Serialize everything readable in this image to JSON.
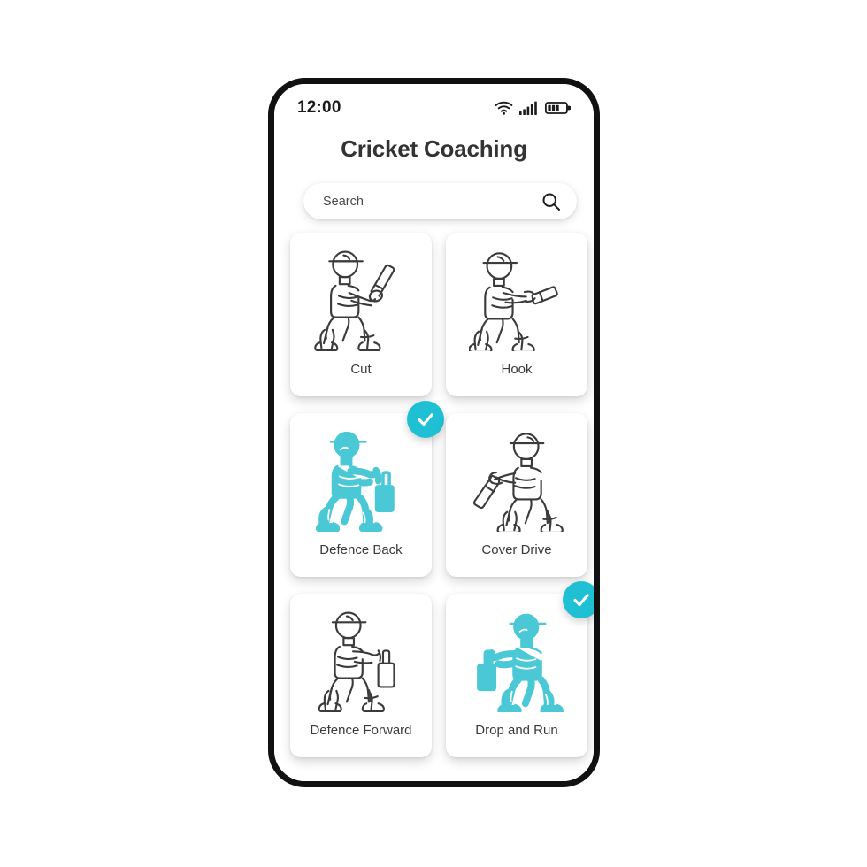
{
  "meta": {
    "accent_color": "#20c0d4",
    "figure_accent_color": "#4ac8d6",
    "outline_color": "#3b3b3b",
    "title_color": "#333333"
  },
  "status_bar": {
    "time": "12:00",
    "icons": [
      "wifi-icon",
      "cellular-signal-icon",
      "battery-icon"
    ]
  },
  "header": {
    "title": "Cricket Coaching"
  },
  "search": {
    "value": "",
    "placeholder": "Search",
    "icon": "search-icon"
  },
  "grid": {
    "cards": [
      {
        "label": "Cut",
        "selected": false,
        "figure": "batsman-cut-icon"
      },
      {
        "label": "Hook",
        "selected": false,
        "figure": "batsman-hook-icon"
      },
      {
        "label": "Defence Back",
        "selected": true,
        "figure": "batsman-defence-back-icon"
      },
      {
        "label": "Cover Drive",
        "selected": false,
        "figure": "batsman-cover-drive-icon"
      },
      {
        "label": "Defence Forward",
        "selected": false,
        "figure": "batsman-defence-forward-icon"
      },
      {
        "label": "Drop and Run",
        "selected": true,
        "figure": "batsman-drop-and-run-icon"
      }
    ],
    "badge_icon": "check-icon"
  }
}
